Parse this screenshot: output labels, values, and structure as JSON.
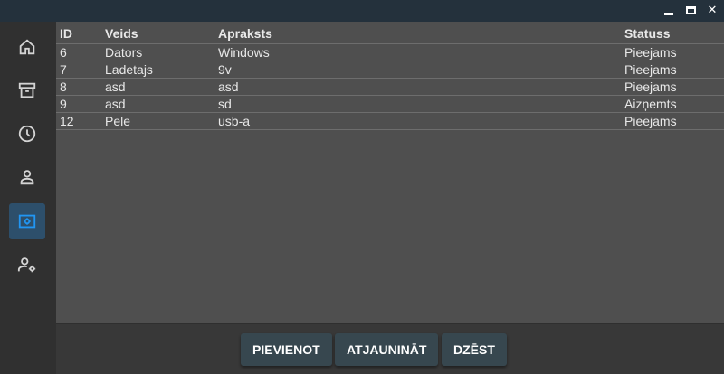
{
  "window": {
    "minimize_glyph": "▁",
    "maximize_glyph": "□",
    "close_glyph": "✕"
  },
  "sidebar": {
    "items": [
      {
        "icon": "home-icon",
        "active": false
      },
      {
        "icon": "archive-icon",
        "active": false
      },
      {
        "icon": "clock-icon",
        "active": false
      },
      {
        "icon": "user-icon",
        "active": false
      },
      {
        "icon": "device-settings-icon",
        "active": true
      },
      {
        "icon": "user-settings-icon",
        "active": false
      }
    ],
    "active_color": "#2d4f6b",
    "icon_color": "#d4d4d4",
    "active_icon_color": "#2196f3"
  },
  "table": {
    "headers": {
      "id": "ID",
      "type": "Veids",
      "description": "Apraksts",
      "status": "Statuss"
    },
    "rows": [
      {
        "id": "6",
        "type": "Dators",
        "description": "Windows",
        "status": "Pieejams"
      },
      {
        "id": "7",
        "type": "Ladetajs",
        "description": "9v",
        "status": "Pieejams"
      },
      {
        "id": "8",
        "type": "asd",
        "description": "asd",
        "status": "Pieejams"
      },
      {
        "id": "9",
        "type": "asd",
        "description": "sd",
        "status": "Aizņemts"
      },
      {
        "id": "12",
        "type": "Pele",
        "description": "usb-a",
        "status": "Pieejams"
      }
    ]
  },
  "buttons": {
    "add": "PIEVIENOT",
    "update": "ATJAUNINĀT",
    "delete": "DZĒST"
  }
}
